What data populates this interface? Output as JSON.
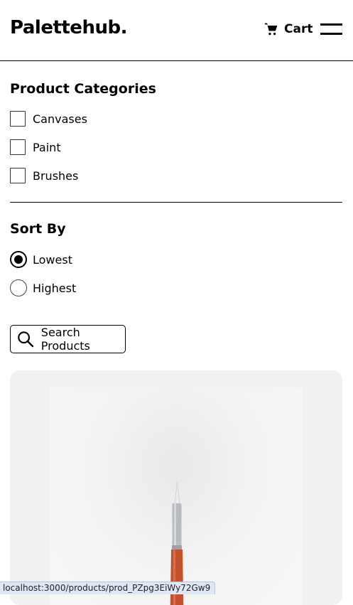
{
  "header": {
    "logo": "Palettehub.",
    "cart_label": "Cart"
  },
  "filters": {
    "categories_title": "Product Categories",
    "categories": [
      {
        "label": "Canvases",
        "checked": false
      },
      {
        "label": "Paint",
        "checked": false
      },
      {
        "label": "Brushes",
        "checked": false
      }
    ],
    "sort_title": "Sort By",
    "sort_options": [
      {
        "label": "Lowest",
        "selected": true
      },
      {
        "label": "Highest",
        "selected": false
      }
    ]
  },
  "search": {
    "label": "Search Products"
  },
  "product_card": {
    "image": "paintbrush-product-image"
  },
  "status_bar": {
    "url": "localhost:3000/products/prod_PZpg3EiWy72Gw9"
  },
  "colors": {
    "card_background": "#f0f1f3",
    "brush_handle": "#c4532d",
    "brush_ferrule": "#b9bcbf"
  },
  "icons": [
    "cart-icon",
    "menu-icon",
    "search-icon"
  ]
}
